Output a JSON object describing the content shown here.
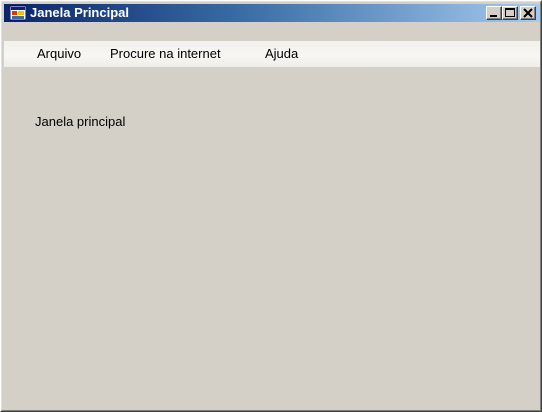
{
  "window": {
    "title": "Janela Principal"
  },
  "titlebar": {
    "buttons": [
      "minimize",
      "maximize",
      "close"
    ]
  },
  "menubar": {
    "items": [
      {
        "label": "Arquivo"
      },
      {
        "label": "Procure na internet"
      },
      {
        "label": "Ajuda"
      }
    ]
  },
  "content": {
    "label": "Janela principal"
  },
  "colors": {
    "titlebar_start": "#0a246a",
    "titlebar_end": "#a6caf0",
    "window_background": "#d4d0c8",
    "menubar_background": "#f5f4f0"
  },
  "icons": {
    "app_icon": "app-window-icon",
    "minimize": "minimize-icon",
    "maximize": "maximize-icon",
    "close": "close-icon"
  }
}
